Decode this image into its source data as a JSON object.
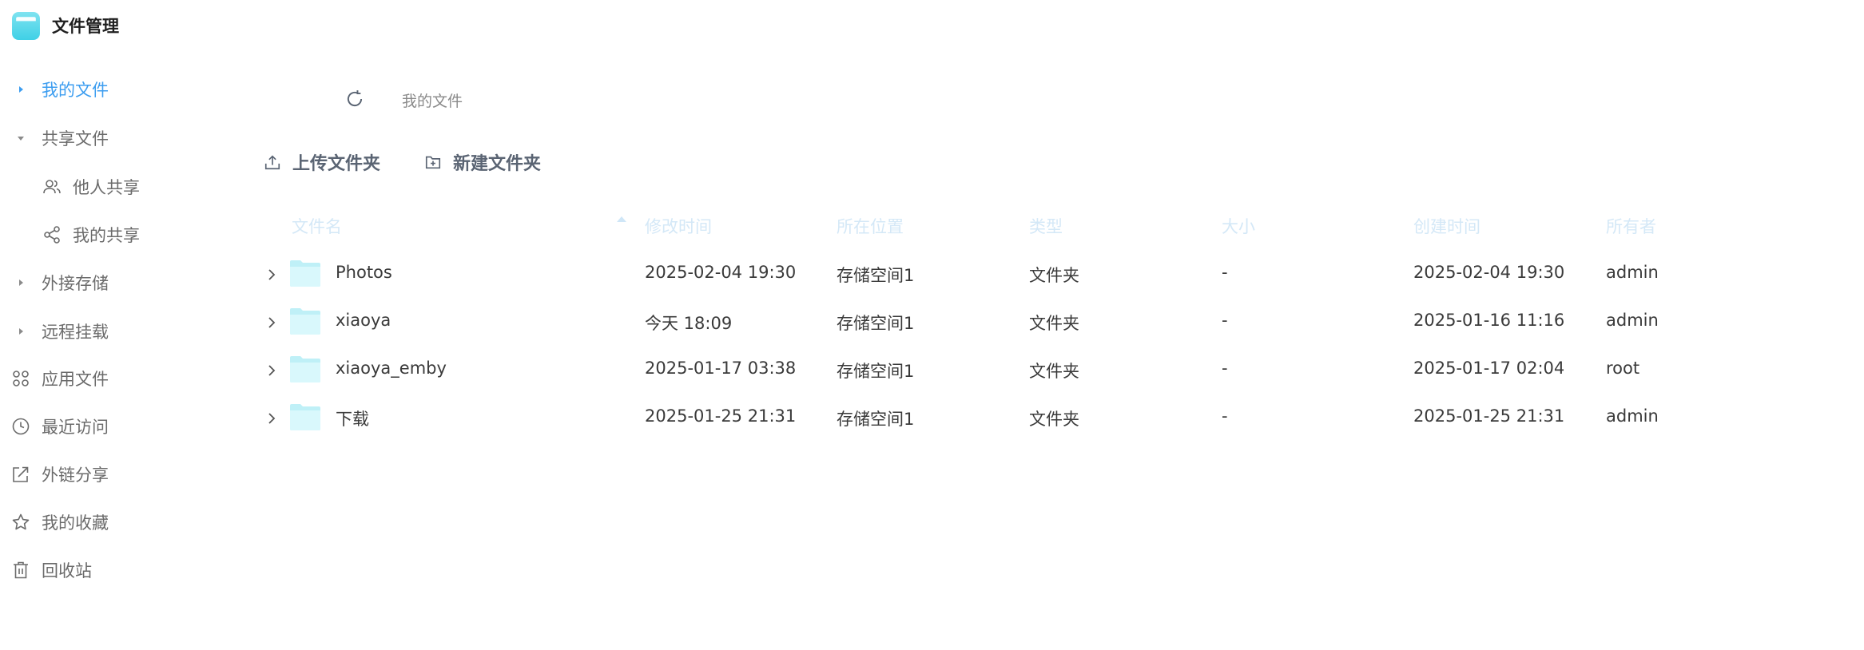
{
  "app": {
    "title": "文件管理"
  },
  "sidebar": {
    "my_files": "我的文件",
    "shared_files": "共享文件",
    "shared_by_others": "他人共享",
    "my_shares": "我的共享",
    "external_storage": "外接存储",
    "remote_mount": "远程挂载",
    "app_files": "应用文件",
    "recent": "最近访问",
    "link_share": "外链分享",
    "favorites": "我的收藏",
    "recycle_bin": "回收站"
  },
  "breadcrumb": "我的文件",
  "toolbar": {
    "upload_folder": "上传文件夹",
    "new_folder": "新建文件夹"
  },
  "table": {
    "headers": {
      "name": "文件名",
      "modified": "修改时间",
      "location": "所在位置",
      "type": "类型",
      "size": "大小",
      "created": "创建时间",
      "owner": "所有者"
    },
    "sort": {
      "column": "name",
      "direction": "ascending"
    },
    "rows": [
      {
        "name": "Photos",
        "modified": "2025-02-04 19:30",
        "location": "存储空间1",
        "type": "文件夹",
        "size": "-",
        "created": "2025-02-04 19:30",
        "owner": "admin"
      },
      {
        "name": "xiaoya",
        "modified": "今天 18:09",
        "location": "存储空间1",
        "type": "文件夹",
        "size": "-",
        "created": "2025-01-16 11:16",
        "owner": "admin"
      },
      {
        "name": "xiaoya_emby",
        "modified": "2025-01-17 03:38",
        "location": "存储空间1",
        "type": "文件夹",
        "size": "-",
        "created": "2025-01-17 02:04",
        "owner": "root"
      },
      {
        "name": "下载",
        "modified": "2025-01-25 21:31",
        "location": "存储空间1",
        "type": "文件夹",
        "size": "-",
        "created": "2025-01-25 21:31",
        "owner": "admin"
      }
    ]
  },
  "colors": {
    "accent": "#3c9df0",
    "folder": "#bff0f7",
    "header_text": "#d4e8f7",
    "toolbar_text": "#5a6473"
  },
  "icons": {
    "logo": "folder-logo",
    "refresh": "refresh-icon",
    "upload": "upload-icon",
    "new_folder": "new-folder-icon",
    "folder": "folder-icon",
    "expand": "chevron-right-icon"
  }
}
